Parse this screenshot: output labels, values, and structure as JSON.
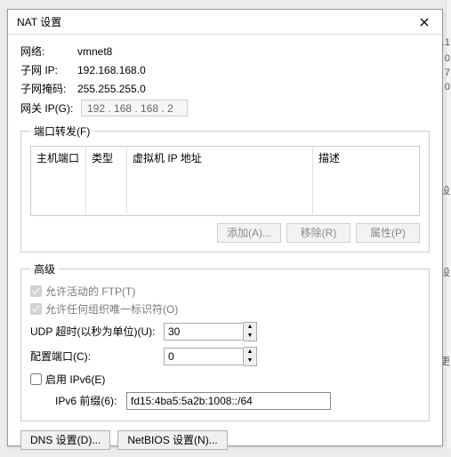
{
  "window": {
    "title": "NAT 设置"
  },
  "network_info": {
    "network_label": "网络:",
    "network_value": "vmnet8",
    "subnet_ip_label": "子网 IP:",
    "subnet_ip_value": "192.168.168.0",
    "subnet_mask_label": "子网掩码:",
    "subnet_mask_value": "255.255.255.0",
    "gateway_label": "网关 IP(G):",
    "gateway_value": "192 . 168 . 168 .  2"
  },
  "port_forwarding": {
    "legend": "端口转发(F)",
    "columns": {
      "host_port": "主机端口",
      "type": "类型",
      "vm_ip_addr": "虚拟机 IP 地址",
      "desc": "描述"
    },
    "buttons": {
      "add": "添加(A)...",
      "remove": "移除(R)",
      "props": "属性(P)"
    }
  },
  "advanced": {
    "legend": "高级",
    "allow_active_ftp": {
      "label": "允许活动的 FTP(T)",
      "checked": true
    },
    "allow_org_id": {
      "label": "允许任何组织唯一标识符(O)",
      "checked": true
    },
    "udp_timeout": {
      "label": "UDP 超时(以秒为单位)(U):",
      "value": "30"
    },
    "config_port": {
      "label": "配置端口(C):",
      "value": "0"
    },
    "enable_ipv6": {
      "label": "启用 IPv6(E)",
      "checked": false
    },
    "ipv6_prefix": {
      "label": "IPv6 前缀(6):",
      "value": "fd15:4ba5:5a2b:1008::/64"
    }
  },
  "bottom": {
    "dns": "DNS 设置(D)...",
    "netbios": "NetBIOS 设置(N)..."
  },
  "bg_fragments": {
    "a": ".1",
    "b": "0",
    "c": "7",
    "d": "0",
    "e": "",
    "s1": "设",
    "s2": "设",
    "s3": "更"
  }
}
